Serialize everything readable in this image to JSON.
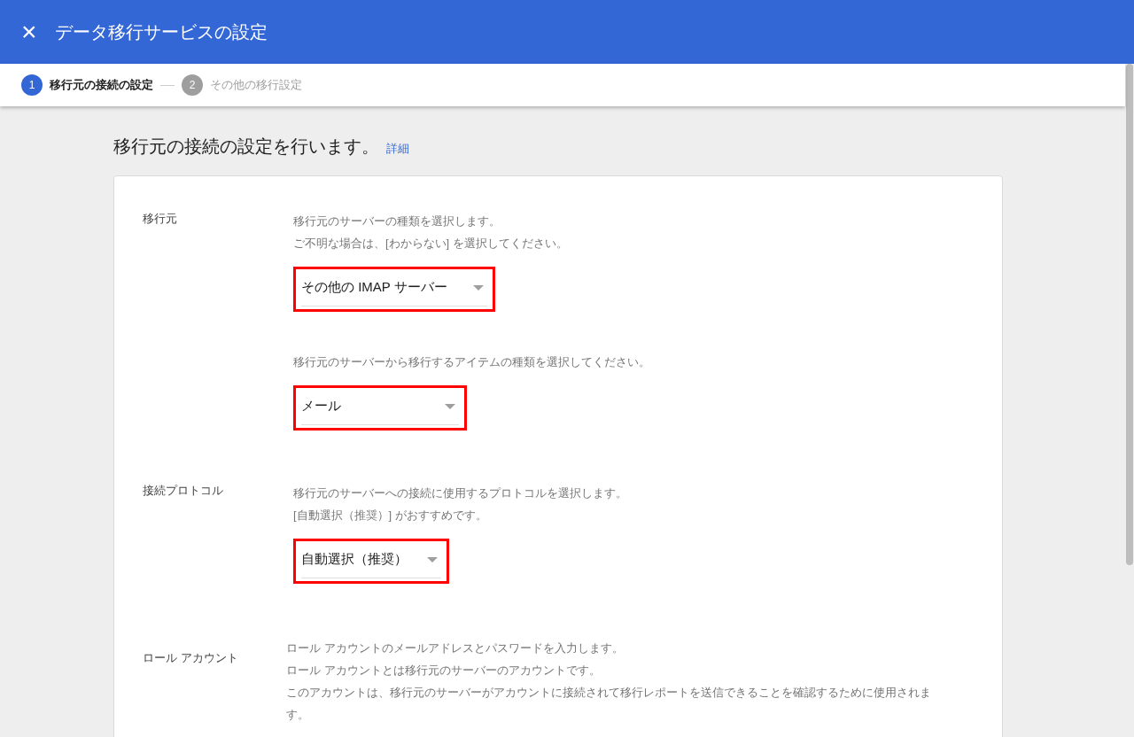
{
  "header": {
    "close": "×",
    "title": "データ移行サービスの設定"
  },
  "steps": [
    {
      "number": "1",
      "label": "移行元の接続の設定",
      "selected": true
    },
    {
      "number": "2",
      "label": "その他の移行設定",
      "selected": false
    }
  ],
  "intro": {
    "text": "移行元の接続の設定を行います。",
    "link": "詳細"
  },
  "sections": [
    {
      "label": "移行元",
      "blocks": [
        {
          "lines": [
            "移行元のサーバーの種類を選択します。",
            "ご不明な場合は、[わからない] を選択してください。"
          ],
          "select": {
            "value": "その他の IMAP サーバー",
            "highlighted": true
          }
        },
        {
          "lines": [
            "移行元のサーバーから移行するアイテムの種類を選択してください。"
          ],
          "select": {
            "value": "メール",
            "highlighted": true
          }
        }
      ]
    },
    {
      "label": "接続プロトコル",
      "blocks": [
        {
          "lines": [
            "移行元のサーバーへの接続に使用するプロトコルを選択します。",
            "[自動選択（推奨）] がおすすめです。"
          ],
          "select": {
            "value": "自動選択（推奨）",
            "highlighted": true
          }
        }
      ]
    },
    {
      "label": "ロール アカウント",
      "blocks": [
        {
          "lines": [
            "ロール アカウントのメールアドレスとパスワードを入力します。",
            "ロール アカウントとは移行元のサーバーのアカウントです。",
            "このアカウントは、移行元のサーバーがアカウントに接続されて移行レポートを送信できることを確認するために使用されます。"
          ]
        }
      ]
    }
  ]
}
